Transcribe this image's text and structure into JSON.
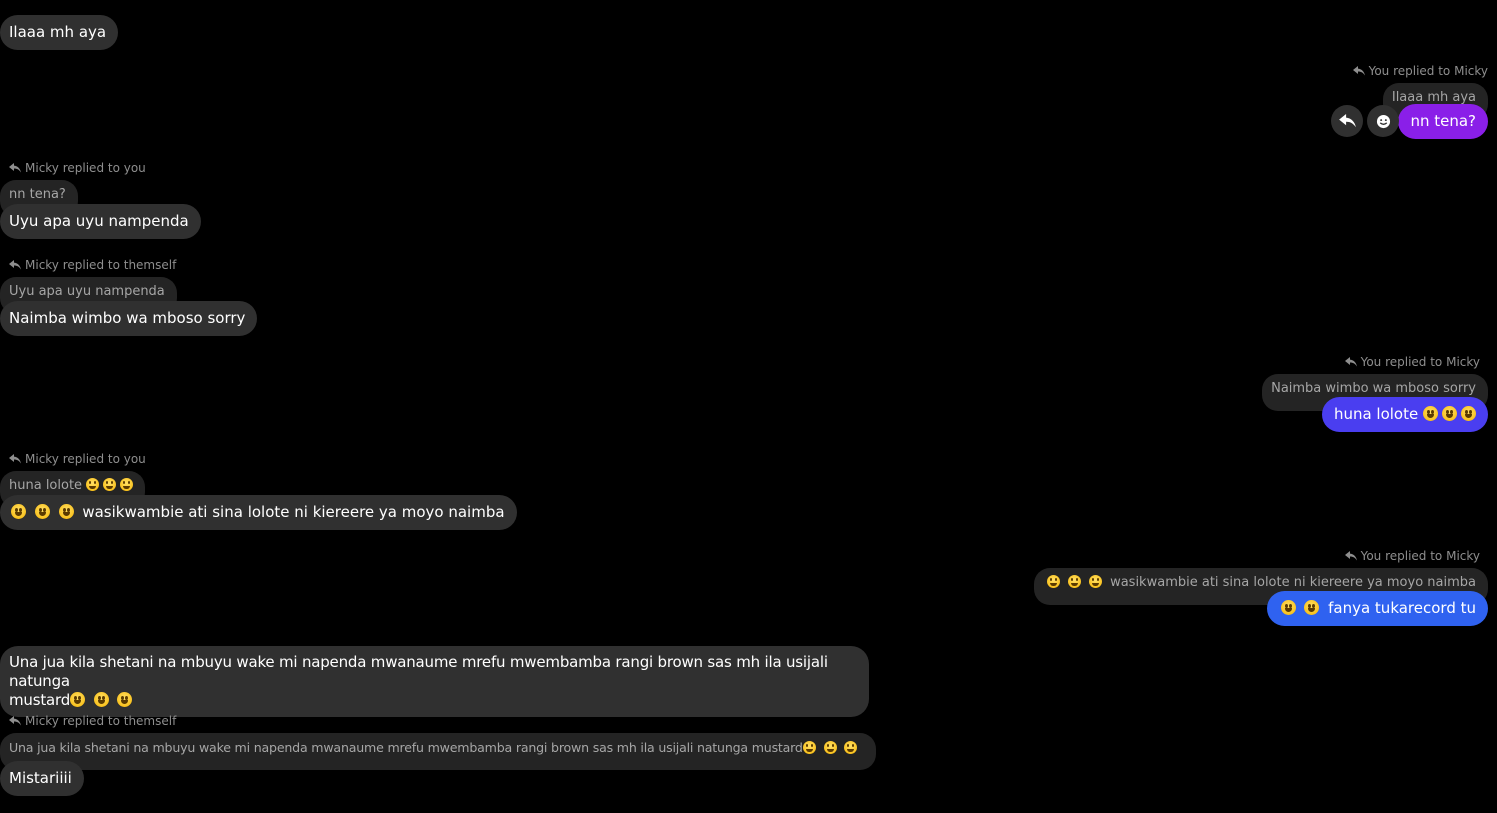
{
  "colors": {
    "background": "#000000",
    "incoming_bubble": "#303030",
    "quote_bubble": "#242424",
    "outgoing_purple": "#8a1fe8",
    "outgoing_indigo": "#4a3ef0",
    "outgoing_blue": "#2f62f0",
    "meta_text": "#8e8e8e"
  },
  "messages": {
    "m1": {
      "text": "Ilaaa mh aya"
    },
    "m2": {
      "reply_label": "You replied to Micky",
      "quote": "Ilaaa mh aya",
      "text": "nn tena?",
      "actions": {
        "reply_icon": "reply-arrow-icon",
        "react_icon": "smiley-icon"
      }
    },
    "m3": {
      "reply_label": "Micky replied to you",
      "quote": "nn tena?",
      "text": "Uyu apa uyu nampenda"
    },
    "m4": {
      "reply_label": "Micky replied to themself",
      "quote": "Uyu apa uyu nampenda",
      "text": "Naimba wimbo wa mboso sorry"
    },
    "m5": {
      "reply_label": "You replied to Micky",
      "quote": "Naimba wimbo wa mboso sorry",
      "text": "huna lolote"
    },
    "m6": {
      "reply_label": "Micky replied to you",
      "quote": "huna lolote",
      "text": "wasikwambie ati sina lolote ni kiereere ya moyo naimba"
    },
    "m7": {
      "reply_label": "You replied to Micky",
      "quote": "wasikwambie ati sina lolote ni kiereere ya moyo naimba",
      "text": "fanya tukarecord tu"
    },
    "m8": {
      "line1": "Una jua kila shetani na mbuyu wake mi napenda mwanaume  mrefu mwembamba rangi brown sas mh ila usijali natunga",
      "line2": "mustard"
    },
    "m9": {
      "reply_label": "Micky replied to themself",
      "quote": "Una jua kila shetani na mbuyu wake mi napenda mwanaume  mrefu mwembamba rangi brown sas mh ila usijali natunga mustard",
      "text": "Mistariiii"
    }
  }
}
